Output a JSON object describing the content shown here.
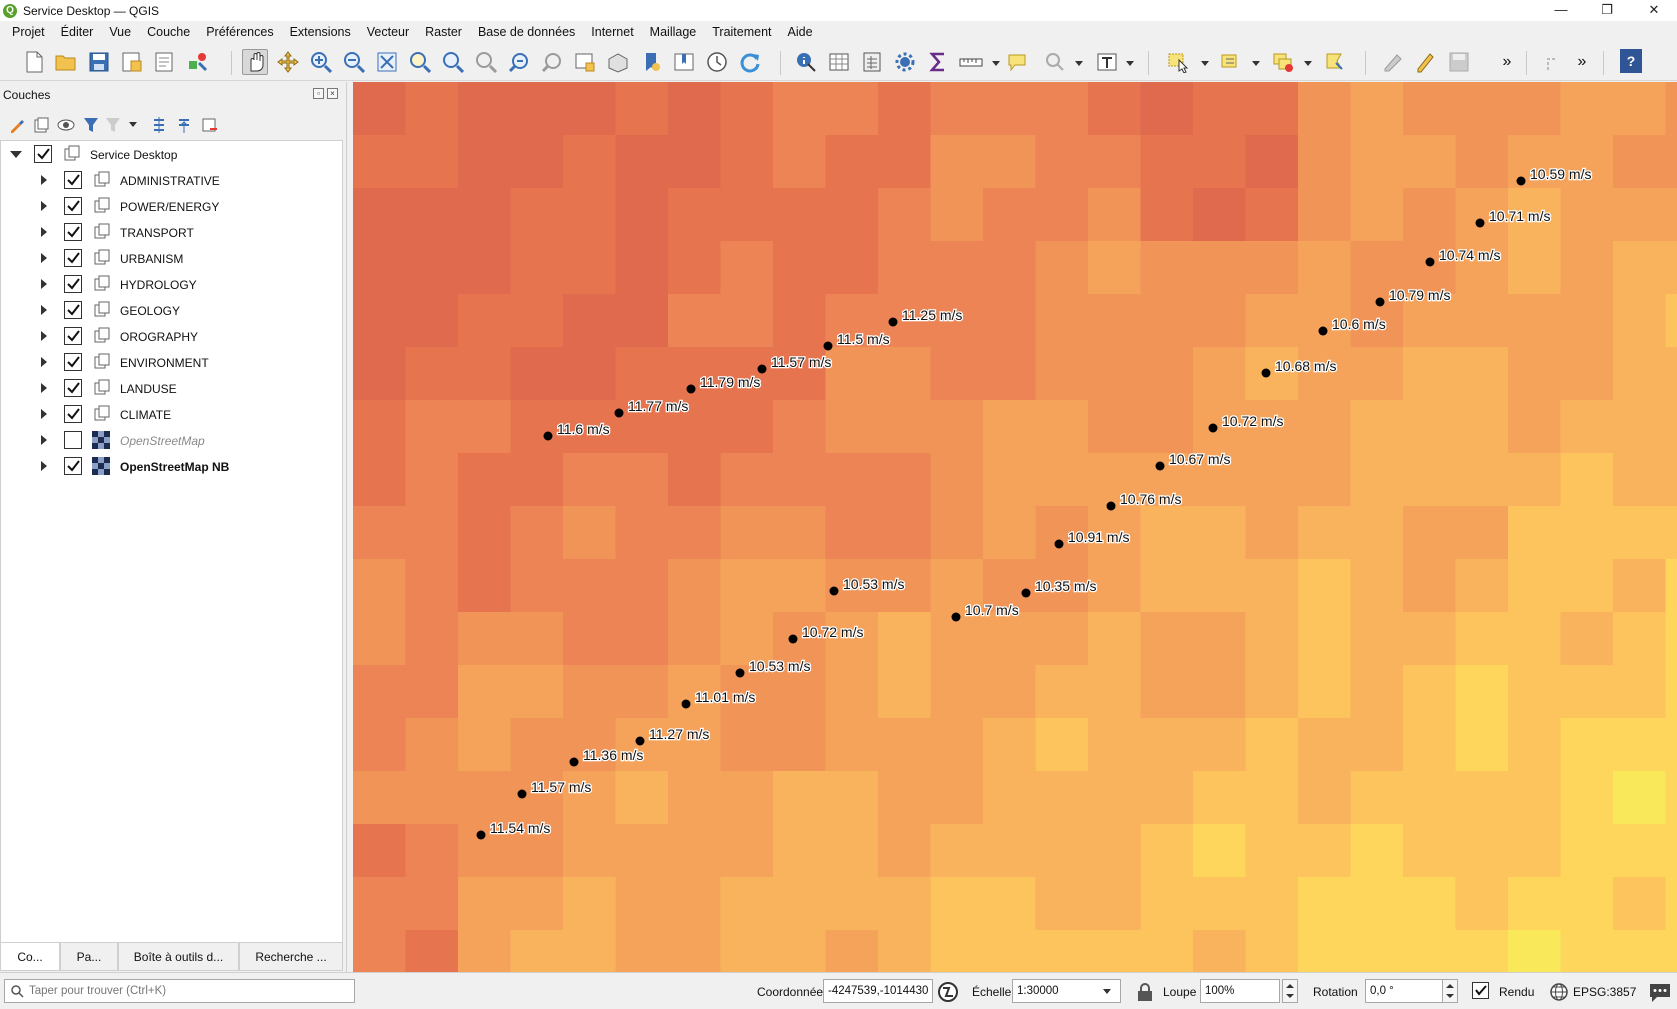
{
  "window": {
    "title": "Service Desktop — QGIS",
    "controls": [
      "—",
      "❐",
      "✕"
    ]
  },
  "menu": [
    "Projet",
    "Éditer",
    "Vue",
    "Couche",
    "Préférences",
    "Extensions",
    "Vecteur",
    "Raster",
    "Base de données",
    "Internet",
    "Maillage",
    "Traitement",
    "Aide"
  ],
  "toolbar": {
    "overflow_1": "»",
    "overflow_2": "»",
    "help": "?"
  },
  "layers_panel": {
    "title": "Couches",
    "group": {
      "name": "Service Desktop",
      "checked": true,
      "expanded": true
    },
    "layers": [
      {
        "name": "ADMINISTRATIVE",
        "checked": true,
        "type": "group"
      },
      {
        "name": "POWER/ENERGY",
        "checked": true,
        "type": "group"
      },
      {
        "name": "TRANSPORT",
        "checked": true,
        "type": "group"
      },
      {
        "name": "URBANISM",
        "checked": true,
        "type": "group"
      },
      {
        "name": "HYDROLOGY",
        "checked": true,
        "type": "group"
      },
      {
        "name": "GEOLOGY",
        "checked": true,
        "type": "group"
      },
      {
        "name": "OROGRAPHY",
        "checked": true,
        "type": "group"
      },
      {
        "name": "ENVIRONMENT",
        "checked": true,
        "type": "group"
      },
      {
        "name": "LANDUSE",
        "checked": true,
        "type": "group"
      },
      {
        "name": "CLIMATE",
        "checked": true,
        "type": "group"
      },
      {
        "name": "OpenStreetMap",
        "checked": false,
        "type": "raster"
      },
      {
        "name": "OpenStreetMap NB",
        "checked": true,
        "type": "raster"
      }
    ],
    "tabs": [
      "Co...",
      "Pa...",
      "Boîte à outils d...",
      "Recherche ..."
    ]
  },
  "map": {
    "raster_colors": [
      "#e06a4e",
      "#e5744f",
      "#ec8455",
      "#f09458",
      "#f5a35b",
      "#f9b35d",
      "#fdc35d",
      "#fdd65b",
      "#f9e859",
      "#f1f05a",
      "#def05d",
      "#c8eb62",
      "#b6e568"
    ],
    "labels": [
      "10.59 m/s",
      "10.71 m/s",
      "10.74 m/s",
      "10.79 m/s",
      "10.6 m/s",
      "10.68 m/s",
      "10.72 m/s",
      "10.67 m/s",
      "10.76 m/s",
      "10.91 m/s",
      "10.35 m/s",
      "10.7 m/s",
      "11.25 m/s",
      "11.5 m/s",
      "11.57 m/s",
      "11.79 m/s",
      "11.77 m/s",
      "11.6 m/s",
      "10.53 m/s",
      "10.72 m/s",
      "10.53 m/s",
      "11.01 m/s",
      "11.27 m/s",
      "11.36 m/s",
      "11.57 m/s",
      "11.54 m/s"
    ]
  },
  "statusbar": {
    "search_placeholder": "Taper pour trouver (Ctrl+K)",
    "coord_label": "Coordonnée",
    "coord_value": "-4247539,-1014430",
    "scale_label": "Échelle",
    "scale_value": "1:30000",
    "magnifier_label": "Loupe",
    "magnifier_value": "100%",
    "rotation_label": "Rotation",
    "rotation_value": "0,0 °",
    "render_label": "Rendu",
    "render_checked": true,
    "crs": "EPSG:3857"
  }
}
